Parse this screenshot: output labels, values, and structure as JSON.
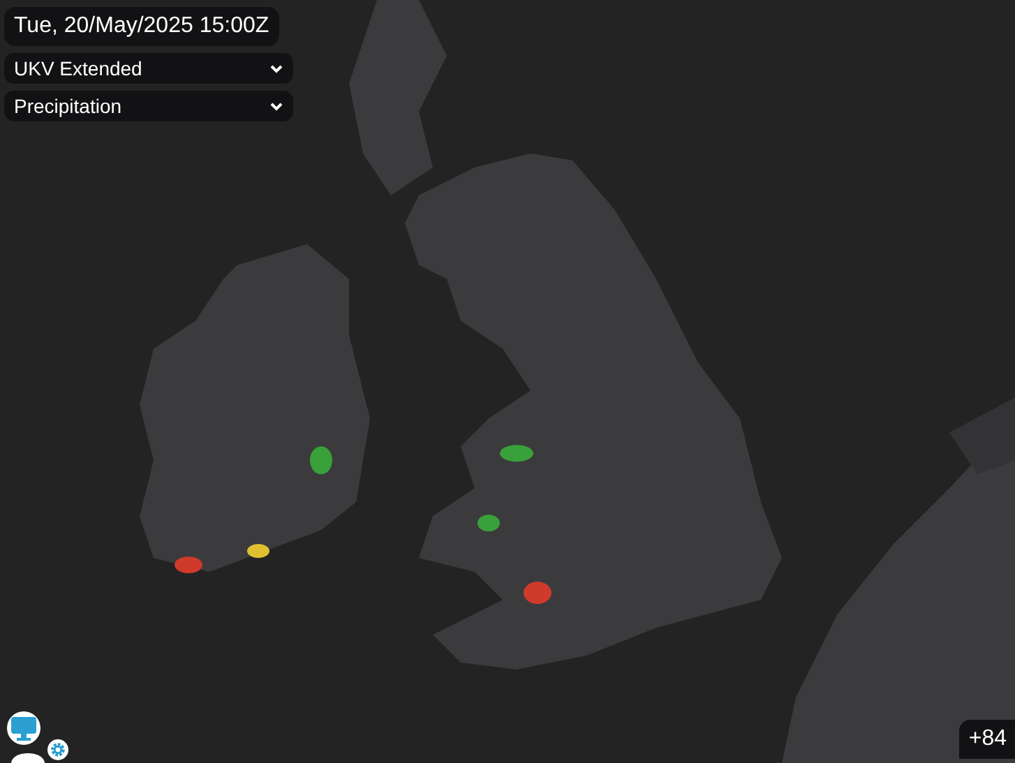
{
  "time_label": "Tue, 20/May/2025 15:00Z",
  "dropdowns": [
    {
      "value": "UKV Extended"
    },
    {
      "value": "Precipitation"
    }
  ],
  "counter_badge": "+84"
}
